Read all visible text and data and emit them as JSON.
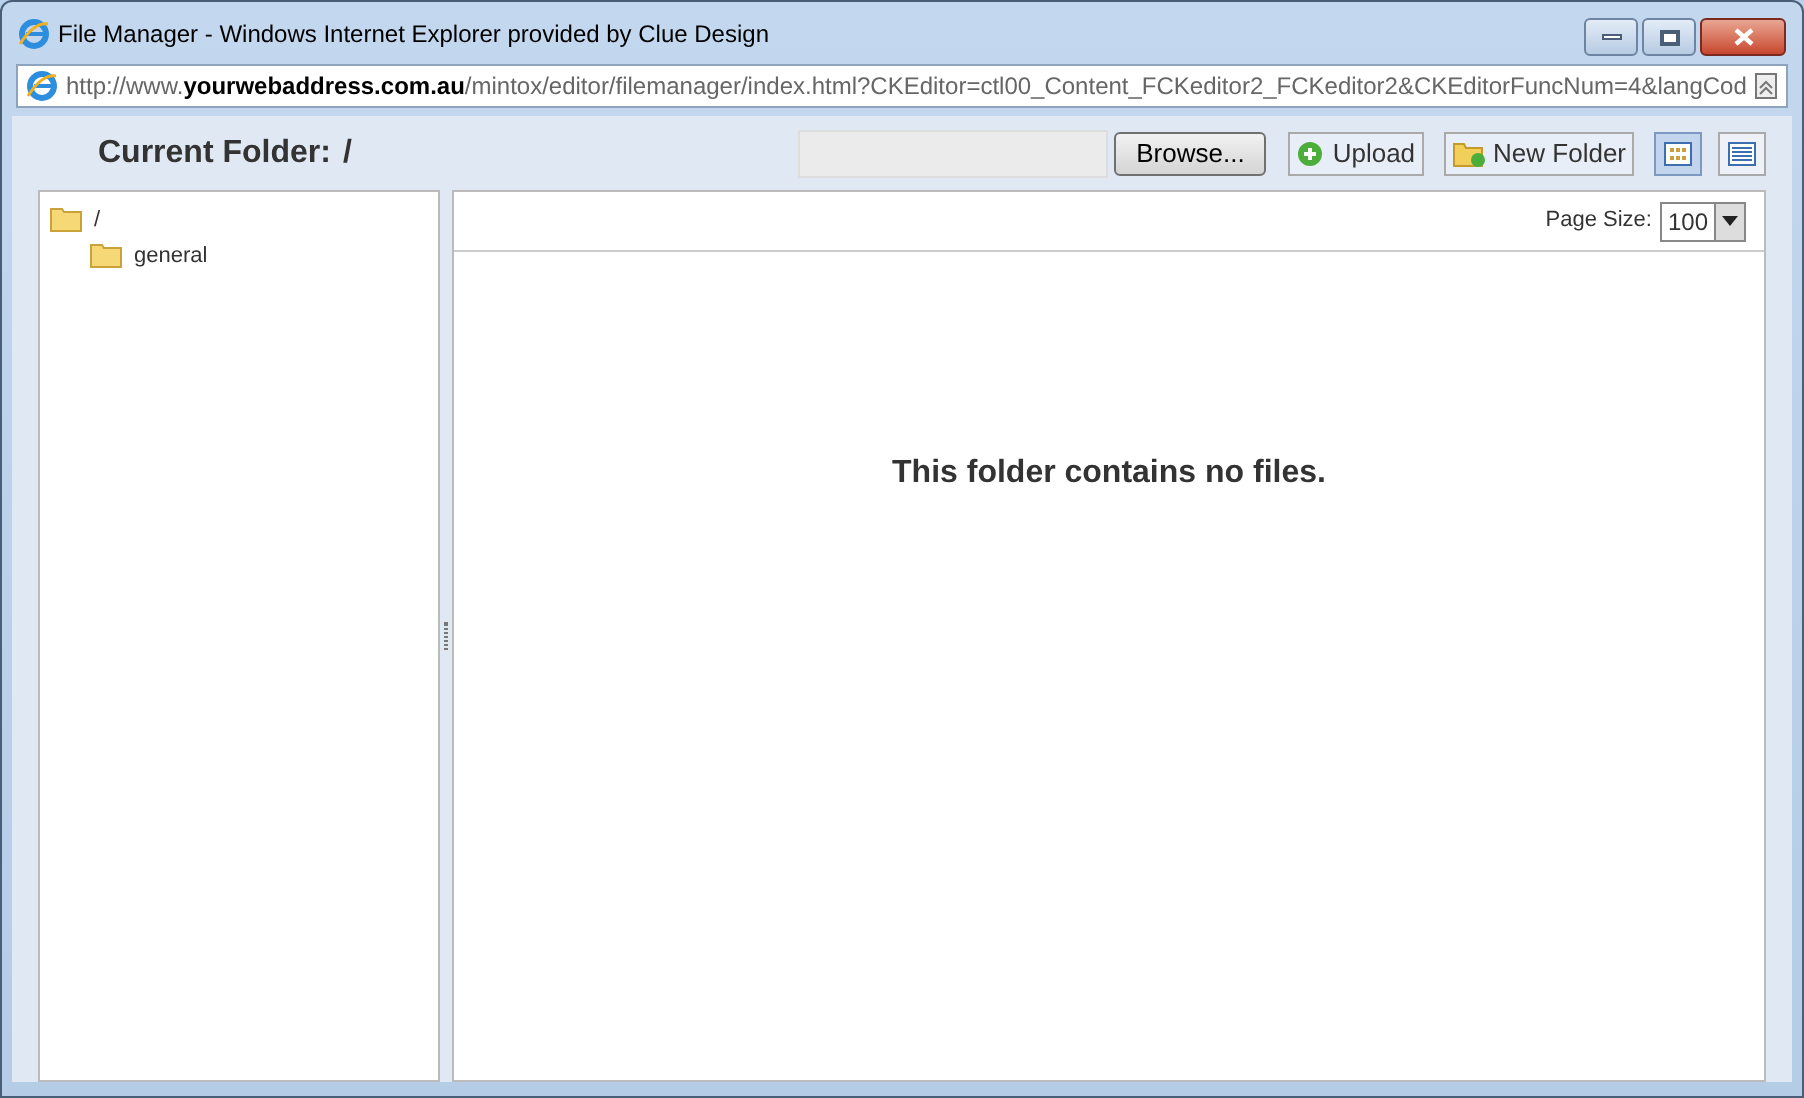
{
  "window": {
    "title": "File Manager - Windows Internet Explorer provided by Clue Design"
  },
  "address_bar": {
    "url": "http://www.**yourwebaddress.com.au**/mintox/editor/filemanager/index.html?CKEditor=ctl00_Content_FCKeditor2_FCKeditor2&CKEditorFuncNum=4&langCod"
  },
  "toolbar": {
    "current_folder_label": "Current Folder:",
    "current_folder": "/",
    "browse_button": "Browse...",
    "upload_button": "Upload",
    "new_folder_button": "New Folder",
    "views": [
      {
        "kind": "thumbnails",
        "selected": true
      },
      {
        "kind": "list",
        "selected": false
      }
    ]
  },
  "folder_tree": [
    {
      "name": "/",
      "children": [
        {
          "name": "general"
        }
      ]
    }
  ],
  "file_list": {
    "page_size_label": "Page Size:",
    "page_size": "100",
    "empty_message": "This folder contains no files."
  }
}
